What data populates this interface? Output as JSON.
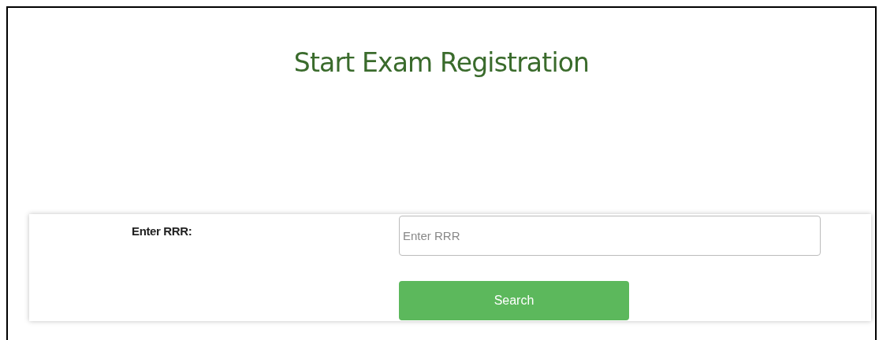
{
  "title": "Start Exam Registration",
  "form": {
    "label": "Enter RRR:",
    "field": {
      "placeholder": "Enter RRR"
    },
    "button": "Search"
  }
}
